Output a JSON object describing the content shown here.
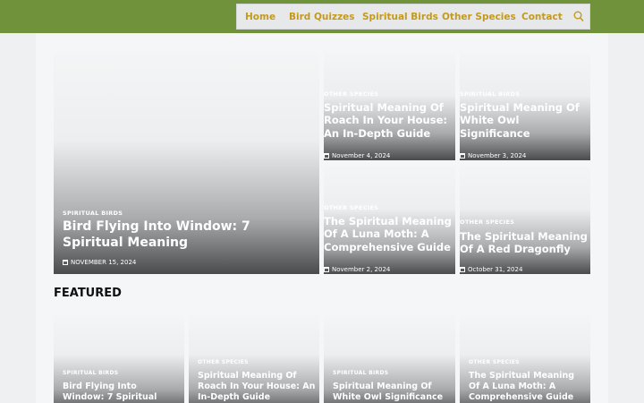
{
  "nav": {
    "items": [
      "Home",
      "Bird Quizzes",
      "Spiritual Birds",
      "Other Species",
      "Contact"
    ],
    "search_icon": "search-icon"
  },
  "hero": {
    "big": {
      "category": "SPIRITUAL BIRDS",
      "title": "Bird Flying Into Window: 7 Spiritual Meaning",
      "date": "NOVEMBER 15, 2024"
    },
    "grid": [
      {
        "category": "OTHER SPECIES",
        "title": "Spiritual Meaning Of Roach In Your House: An In-Depth Guide",
        "date": "November 4, 2024"
      },
      {
        "category": "SPIRITUAL BIRDS",
        "title": "Spiritual Meaning Of White Owl Significance",
        "date": "November 3, 2024"
      },
      {
        "category": "OTHER SPECIES",
        "title": "The Spiritual Meaning Of A Luna Moth: A Comprehensive Guide",
        "date": "November 2, 2024"
      },
      {
        "category": "OTHER SPECIES",
        "title": "The Spiritual Meaning Of A Red Dragonfly",
        "date": "October 31, 2024"
      }
    ]
  },
  "featured": {
    "heading": "FEATURED",
    "items": [
      {
        "category": "SPIRITUAL BIRDS",
        "title": "Bird Flying Into Window: 7 Spiritual Meaning"
      },
      {
        "category": "OTHER SPECIES",
        "title": "Spiritual Meaning Of Roach In Your House: An In-Depth Guide"
      },
      {
        "category": "SPIRITUAL BIRDS",
        "title": "Spiritual Meaning Of White Owl Significance"
      },
      {
        "category": "OTHER SPECIES",
        "title": "The Spiritual Meaning Of A Luna Moth: A Comprehensive Guide"
      }
    ]
  },
  "colors": {
    "header_green": "#70923a",
    "nav_link_gold": "#c49a1c"
  }
}
